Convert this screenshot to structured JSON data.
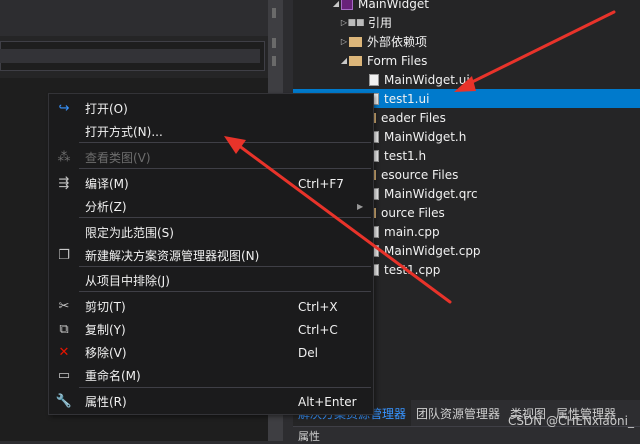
{
  "solution_explorer": {
    "rows": [
      {
        "arrow": "◢",
        "icon": "proj",
        "label": "MainWidget"
      },
      {
        "arrow": "▷",
        "icon": "ref",
        "label": "引用"
      },
      {
        "arrow": "▷",
        "icon": "folder",
        "label": "外部依赖项"
      },
      {
        "arrow": "◢",
        "icon": "folder",
        "label": "Form Files"
      },
      {
        "arrow": "",
        "icon": "file",
        "label": "MainWidget.ui"
      },
      {
        "arrow": "",
        "icon": "file",
        "label": "test1.ui"
      },
      {
        "arrow": "",
        "icon": "folder",
        "label": "eader Files"
      },
      {
        "arrow": "",
        "icon": "file",
        "label": "MainWidget.h"
      },
      {
        "arrow": "",
        "icon": "file",
        "label": "test1.h"
      },
      {
        "arrow": "",
        "icon": "folder",
        "label": "esource Files"
      },
      {
        "arrow": "",
        "icon": "file",
        "label": "MainWidget.qrc"
      },
      {
        "arrow": "",
        "icon": "folder",
        "label": "ource Files"
      },
      {
        "arrow": "",
        "icon": "file",
        "label": "main.cpp"
      },
      {
        "arrow": "",
        "icon": "file",
        "label": "MainWidget.cpp"
      },
      {
        "arrow": "",
        "icon": "file",
        "label": "test1.cpp"
      }
    ]
  },
  "tabs": [
    {
      "label": "解决方案资源管理器",
      "active": true
    },
    {
      "label": "团队资源管理器",
      "active": false
    },
    {
      "label": "类视图",
      "active": false
    },
    {
      "label": "属性管理器",
      "active": false
    }
  ],
  "properties_label": "属性",
  "watermark": "CSDN @CHENxiaoni_",
  "context_menu": {
    "items": [
      {
        "label": "打开(O)",
        "shortcut": "",
        "icon": "open-arrow-icon",
        "glyph": "↪",
        "glyph_color": "#3794ff",
        "disabled": false,
        "submenu": false
      },
      {
        "label": "打开方式(N)...",
        "shortcut": "",
        "icon": "",
        "glyph": "",
        "disabled": false,
        "submenu": false
      },
      {
        "label": "查看类图(V)",
        "shortcut": "",
        "icon": "class-diagram-icon",
        "glyph": "⁂",
        "glyph_color": "#6d6d6d",
        "disabled": true,
        "submenu": false
      },
      {
        "label": "编译(M)",
        "shortcut": "Ctrl+F7",
        "icon": "compile-icon",
        "glyph": "⇶",
        "glyph_color": "#c8c8c8",
        "disabled": false,
        "submenu": false
      },
      {
        "label": "分析(Z)",
        "shortcut": "",
        "icon": "",
        "glyph": "",
        "disabled": false,
        "submenu": true
      },
      {
        "label": "限定为此范围(S)",
        "shortcut": "",
        "icon": "",
        "glyph": "",
        "disabled": false,
        "submenu": false
      },
      {
        "label": "新建解决方案资源管理器视图(N)",
        "shortcut": "",
        "icon": "new-view-icon",
        "glyph": "❐",
        "glyph_color": "#c8c8c8",
        "disabled": false,
        "submenu": false
      },
      {
        "label": "从项目中排除(J)",
        "shortcut": "",
        "icon": "",
        "glyph": "",
        "disabled": false,
        "submenu": false
      },
      {
        "label": "剪切(T)",
        "shortcut": "Ctrl+X",
        "icon": "scissors-icon",
        "glyph": "✂",
        "glyph_color": "#c8c8c8",
        "disabled": false,
        "submenu": false
      },
      {
        "label": "复制(Y)",
        "shortcut": "Ctrl+C",
        "icon": "copy-icon",
        "glyph": "⧉",
        "glyph_color": "#c8c8c8",
        "disabled": false,
        "submenu": false
      },
      {
        "label": "移除(V)",
        "shortcut": "Del",
        "icon": "remove-x-icon",
        "glyph": "✕",
        "glyph_color": "#e51400",
        "disabled": false,
        "submenu": false
      },
      {
        "label": "重命名(M)",
        "shortcut": "",
        "icon": "rename-icon",
        "glyph": "▭",
        "glyph_color": "#c8c8c8",
        "disabled": false,
        "submenu": false
      },
      {
        "label": "属性(R)",
        "shortcut": "Alt+Enter",
        "icon": "wrench-icon",
        "glyph": "🔧",
        "glyph_color": "#c8c8c8",
        "disabled": false,
        "submenu": false
      }
    ]
  },
  "colors": {
    "selection": "#007acc",
    "annotation_arrow": "#e8332a",
    "active_tab_text": "#3794ff"
  }
}
